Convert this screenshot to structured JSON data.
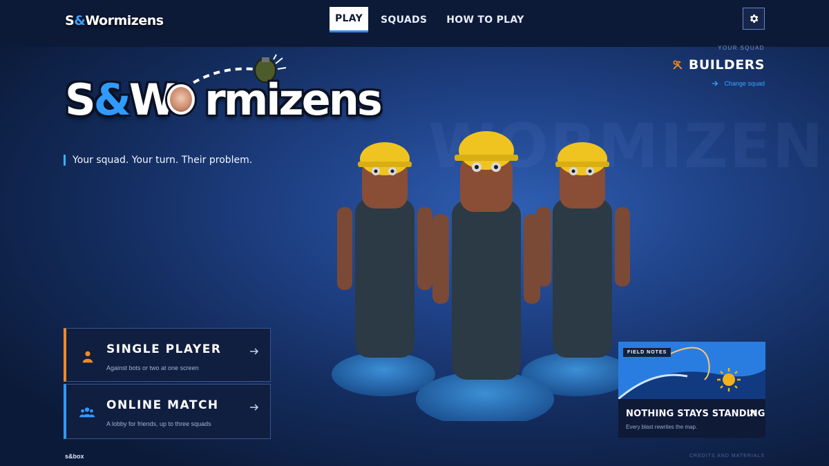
{
  "topbar": {
    "brand": {
      "part1": "S",
      "amp": "&",
      "part2": "Wormizens"
    },
    "tabs": [
      {
        "label": "PLAY",
        "active": true
      },
      {
        "label": "SQUADS",
        "active": false
      },
      {
        "label": "HOW TO PLAY",
        "active": false
      }
    ],
    "settings_icon": "gear-icon"
  },
  "squad": {
    "caption": "YOUR SQUAD",
    "name": "BUILDERS",
    "icon": "hammer-wrench-icon",
    "change_label": "Change squad"
  },
  "logo": {
    "part1": "S",
    "amp": "&",
    "part2": "W",
    "part3": "rmizens"
  },
  "tagline": "Your squad. Your turn. Their problem.",
  "watermark": "WORMIZENS",
  "modes": [
    {
      "title": "SINGLE PLAYER",
      "subtitle": "Against bots or two at one screen",
      "icon": "person-icon",
      "accent": "#f08a24"
    },
    {
      "title": "ONLINE MATCH",
      "subtitle": "A lobby for friends, up to three squads",
      "icon": "group-icon",
      "accent": "#2f9bff"
    }
  ],
  "field_notes": {
    "badge": "FIELD NOTES",
    "title": "NOTHING STAYS STANDING",
    "subtitle": "Every blast rewrites the map."
  },
  "footer": {
    "platform": "s&box",
    "credits": "CREDITS AND MATERIALS"
  },
  "colors": {
    "accent_blue": "#2f9bff",
    "accent_orange": "#f08a24",
    "topbar_bg": "#0d1a37"
  }
}
